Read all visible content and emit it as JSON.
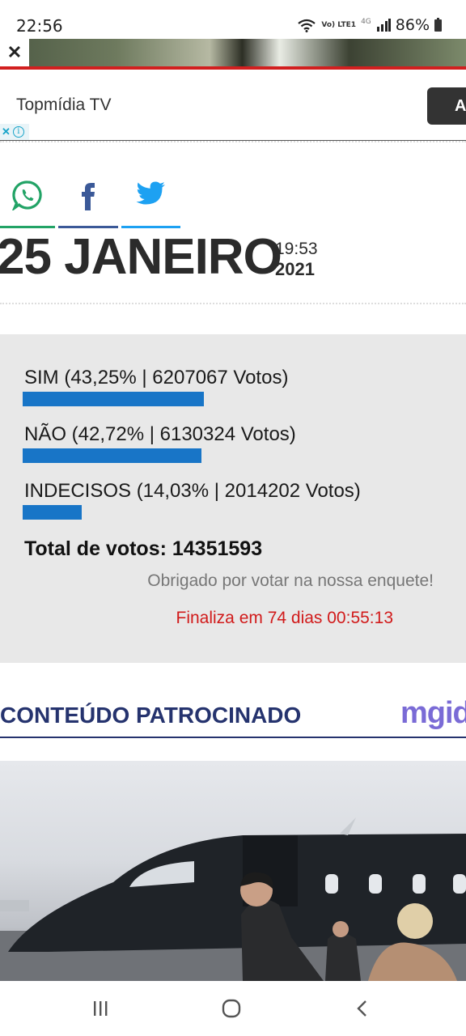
{
  "status_bar": {
    "time": "22:56",
    "network_label": "Vo) LTE1",
    "network_type": "4G",
    "battery": "86%",
    "icons": [
      "wifi-icon",
      "signal-icon",
      "battery-icon"
    ]
  },
  "ad": {
    "close_icon": "close-icon",
    "advertiser": "Topmídia TV",
    "cta_label": "A",
    "adchoices_icon": "adchoices-icon"
  },
  "share": {
    "icons": [
      "whatsapp-icon",
      "facebook-icon",
      "twitter-icon"
    ],
    "colors": {
      "whatsapp": "#22a366",
      "facebook": "#3b5998",
      "twitter": "#1da1f2"
    }
  },
  "post": {
    "date": "25 JANEIRO",
    "time": "19:53",
    "year": "2021"
  },
  "poll": {
    "bar_color": "#1875c7",
    "options": [
      {
        "label": "SIM (43,25% | 6207067 Votos)",
        "percent": 43.25
      },
      {
        "label": "NÃO (42,72% | 6130324 Votos)",
        "percent": 42.72
      },
      {
        "label": "INDECISOS (14,03% | 2014202 Votos)",
        "percent": 14.03
      }
    ],
    "total": "Total de votos: 14351593",
    "thanks": "Obrigado por votar na nossa enquete!",
    "countdown": "Finaliza em 74 dias 00:55:13"
  },
  "sponsored": {
    "title": "CONTEÚDO PATROCINADO",
    "logo": "mgid"
  },
  "nav": {
    "icons": [
      "recents-icon",
      "home-icon",
      "back-icon"
    ]
  }
}
